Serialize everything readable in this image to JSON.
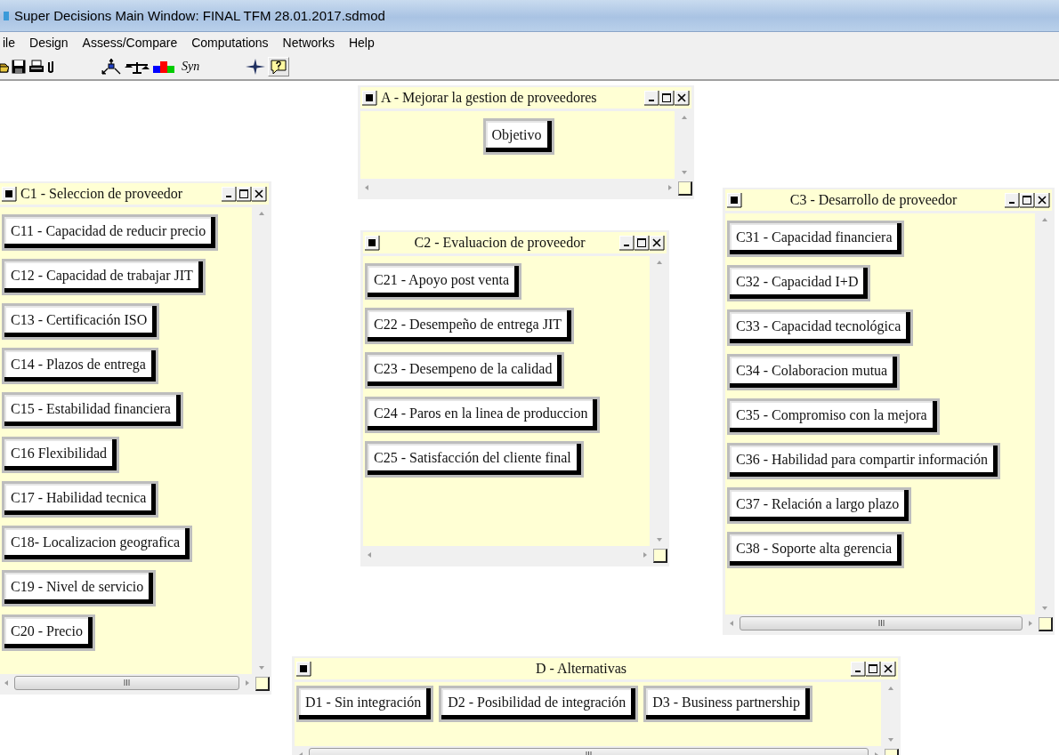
{
  "window": {
    "title": "Super Decisions Main Window: FINAL TFM 28.01.2017.sdmod"
  },
  "menu": [
    {
      "label": "ile"
    },
    {
      "label": "Design"
    },
    {
      "label": "Assess/Compare"
    },
    {
      "label": "Computations"
    },
    {
      "label": "Networks"
    },
    {
      "label": "Help"
    }
  ],
  "toolbar": {
    "text_button": "Syn"
  },
  "clusters": [
    {
      "title": "A - Mejorar la gestion de proveedores",
      "nodes": [
        "Objetivo"
      ]
    },
    {
      "title": "C1 - Seleccion de proveedor",
      "nodes": [
        "C11 - Capacidad de reducir precio",
        "C12 - Capacidad de trabajar JIT",
        "C13 - Certificación ISO",
        "C14 - Plazos de entrega",
        "C15 - Estabilidad financiera",
        "C16 Flexibilidad",
        "C17 - Habilidad tecnica",
        "C18- Localizacion geografica",
        "C19 - Nivel de servicio",
        "C20 - Precio"
      ]
    },
    {
      "title": "C2 - Evaluacion de proveedor",
      "nodes": [
        "C21 - Apoyo post venta",
        "C22 - Desempeño de entrega JIT",
        "C23 - Desempeno de la calidad",
        "C24 - Paros en la linea de produccion",
        "C25 - Satisfacción del cliente final"
      ]
    },
    {
      "title": "C3 - Desarrollo de proveedor",
      "nodes": [
        "C31 - Capacidad financiera",
        "C32 - Capacidad I+D",
        "C33 - Capacidad tecnológica",
        "C34 - Colaboracion mutua",
        "C35 - Compromiso con la mejora",
        "C36 - Habilidad para compartir información",
        "C37 - Relación a largo plazo",
        "C38 - Soporte alta gerencia"
      ]
    },
    {
      "title": "D - Alternativas",
      "nodes": [
        "D1 - Sin integración",
        "D2 - Posibilidad de integración",
        "D3 - Business partnership"
      ]
    }
  ]
}
